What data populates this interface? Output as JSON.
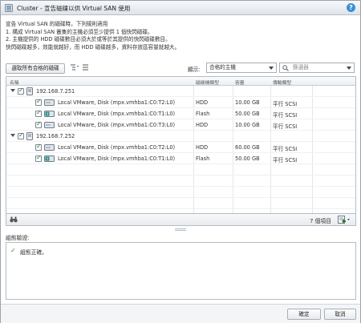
{
  "window": {
    "title": "Cluster - 宣告磁碟以供 Virtual SAN 使用",
    "help_label": "?"
  },
  "intro": {
    "lines": [
      "宣告 Virtual SAN 的磁碟時，下列規則適用",
      "1. 構成 Virtual SAN 叢集的主機必須至少提供 1 個快閃磁碟。",
      "2. 主機提供的 HDD 磁碟數目必須大於或等於其提供的快閃磁碟數目。",
      "快閃磁碟越多，效能就越好，而 HDD 磁碟越多，資料存放區容量就越大。"
    ]
  },
  "toolbar": {
    "select_all_label": "選取所有合格的磁碟",
    "show_label": "顯示:",
    "show_value": "合格的主機",
    "filter_placeholder": "篩選器"
  },
  "grid": {
    "columns": [
      "名稱",
      "磁碟機類型",
      "容量",
      "傳輸類型"
    ],
    "hosts": [
      {
        "name": "192.168.7.251",
        "disks": [
          {
            "name": "Local VMware, Disk (mpx.vmhba1:C0:T2:L0)",
            "type": "HDD",
            "capacity": "10.00 GB",
            "transport": "平行 SCSI",
            "icon": "hdd-disk-icon"
          },
          {
            "name": "Local VMware, Disk (mpx.vmhba1:C0:T1:L0)",
            "type": "Flash",
            "capacity": "50.00 GB",
            "transport": "平行 SCSI",
            "icon": "flash-disk-icon"
          },
          {
            "name": "Local VMware, Disk (mpx.vmhba1:C0:T3:L0)",
            "type": "HDD",
            "capacity": "10.00 GB",
            "transport": "平行 SCSI",
            "icon": "hdd-disk-icon"
          }
        ]
      },
      {
        "name": "192.168.7.252",
        "disks": [
          {
            "name": "Local VMware, Disk (mpx.vmhba1:C0:T2:L0)",
            "type": "HDD",
            "capacity": "60.00 GB",
            "transport": "平行 SCSI",
            "icon": "hdd-disk-icon"
          },
          {
            "name": "Local VMware, Disk (mpx.vmhba1:C0:T1:L0)",
            "type": "Flash",
            "capacity": "50.00 GB",
            "transport": "平行 SCSI",
            "icon": "flash-disk-icon"
          }
        ]
      }
    ],
    "item_count": "7 個項目"
  },
  "validation": {
    "label": "組態驗證:",
    "message": "組態正確。"
  },
  "buttons": {
    "ok": "確定",
    "cancel": "取消"
  },
  "colors": {
    "accent": "#3b8fd4",
    "ok_green": "#3a8a2a",
    "flash_teal": "#1e8a86"
  }
}
